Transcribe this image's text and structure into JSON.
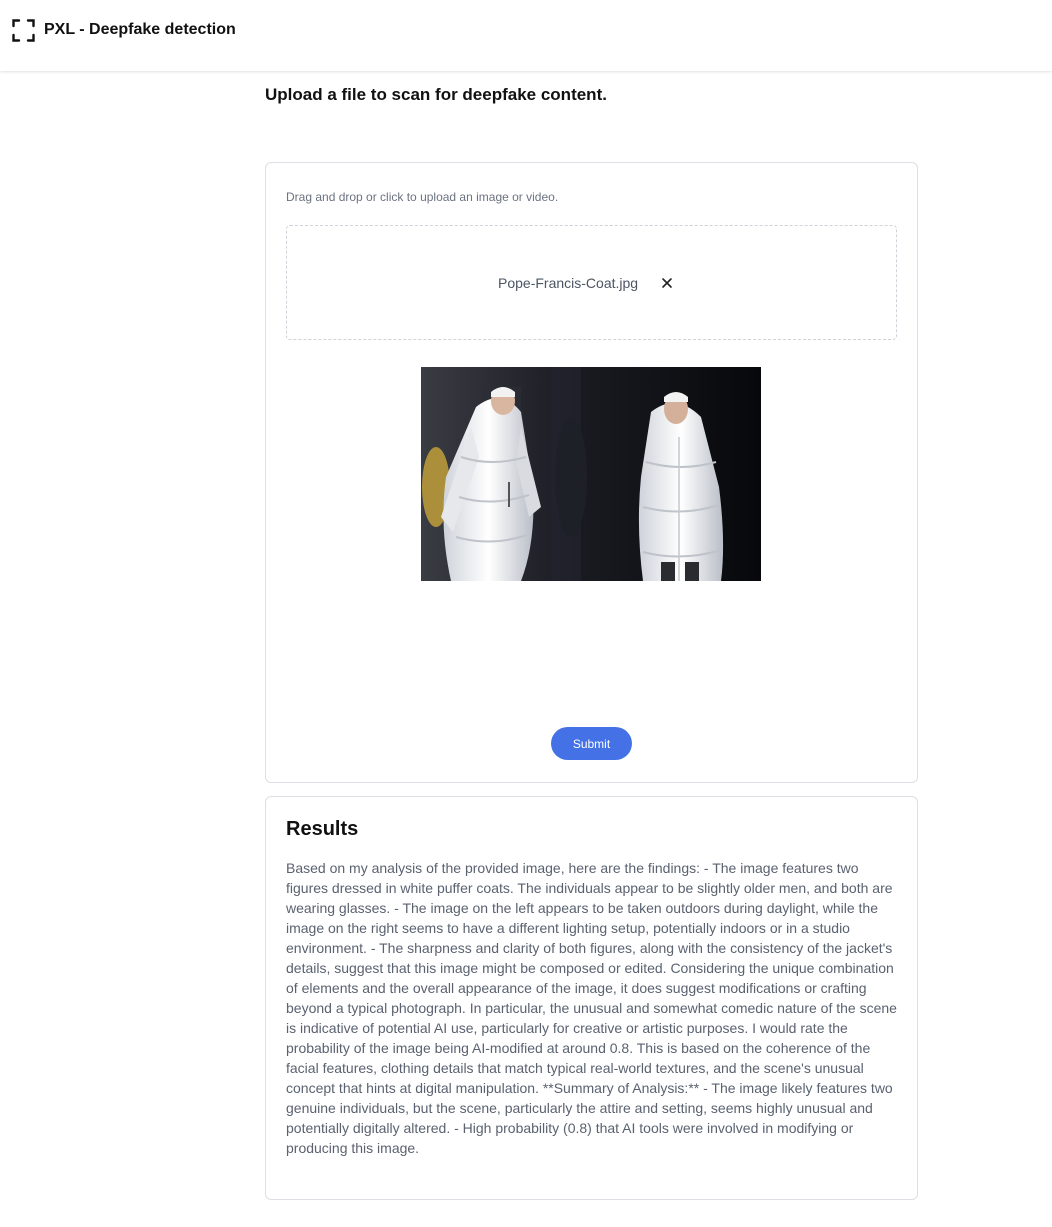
{
  "header": {
    "logo_icon": "scan-frame-icon",
    "title": "PXL - Deepfake detection"
  },
  "page": {
    "heading": "Upload a file to scan for deepfake content."
  },
  "upload": {
    "hint": "Drag and drop or click to upload an image or video.",
    "file_name": "Pope-Francis-Coat.jpg",
    "remove_icon": "close-icon",
    "preview_image": "photo of two figures in white puffer coats",
    "submit_label": "Submit",
    "accent_color": "#4472e6"
  },
  "results": {
    "title": "Results",
    "text": "Based on my analysis of the provided image, here are the findings: - The image features two figures dressed in white puffer coats. The individuals appear to be slightly older men, and both are wearing glasses. - The image on the left appears to be taken outdoors during daylight, while the image on the right seems to have a different lighting setup, potentially indoors or in a studio environment. - The sharpness and clarity of both figures, along with the consistency of the jacket's details, suggest that this image might be composed or edited. Considering the unique combination of elements and the overall appearance of the image, it does suggest modifications or crafting beyond a typical photograph. In particular, the unusual and somewhat comedic nature of the scene is indicative of potential AI use, particularly for creative or artistic purposes. I would rate the probability of the image being AI-modified at around 0.8. This is based on the coherence of the facial features, clothing details that match typical real-world textures, and the scene's unusual concept that hints at digital manipulation. **Summary of Analysis:** - The image likely features two genuine individuals, but the scene, particularly the attire and setting, seems highly unusual and potentially digitally altered. - High probability (0.8) that AI tools were involved in modifying or producing this image."
  }
}
